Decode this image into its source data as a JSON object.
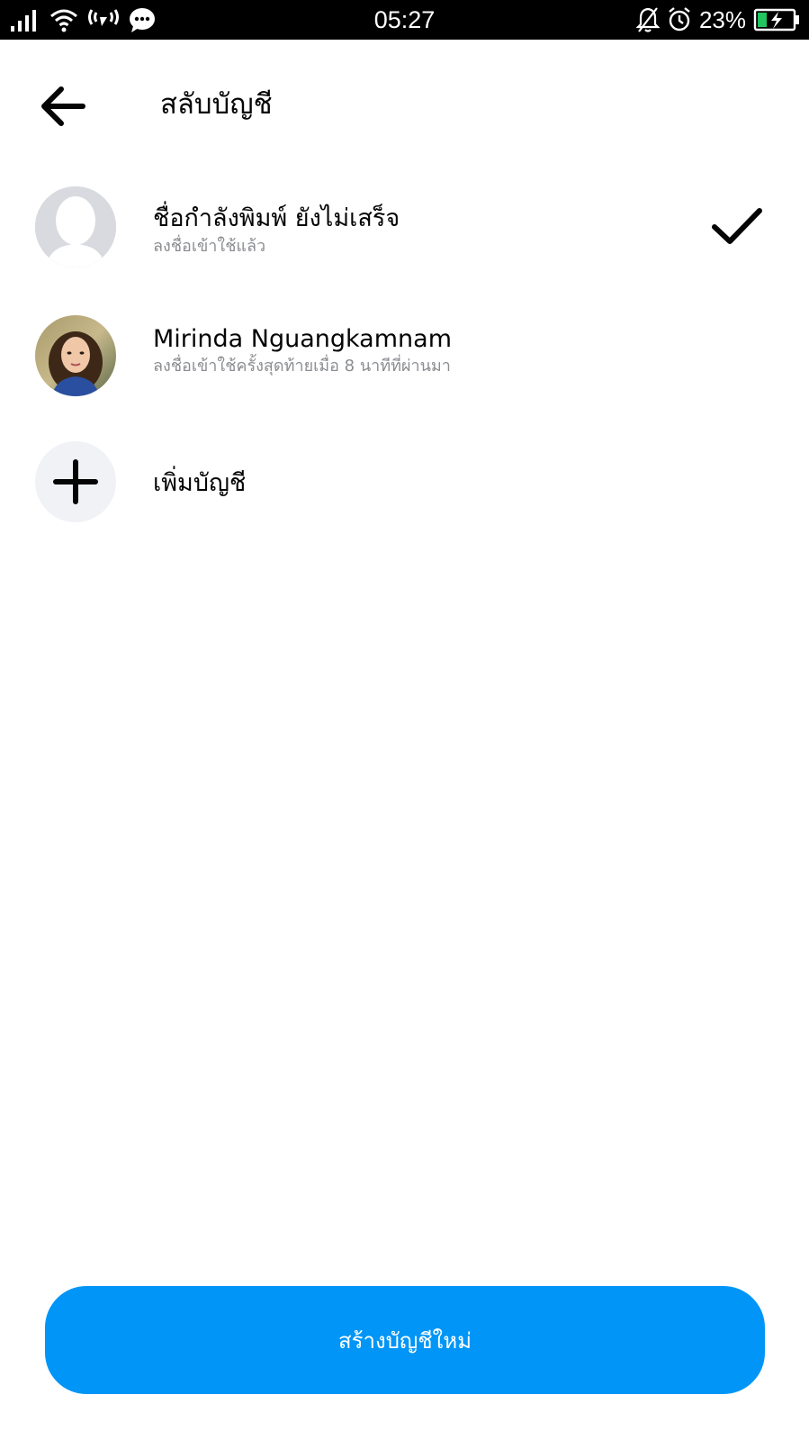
{
  "status_bar": {
    "time": "05:27",
    "battery": "23%",
    "colors": {
      "background": "#000000",
      "battery_fill": "#22c55e"
    }
  },
  "header": {
    "title": "สลับบัญชี",
    "back_icon": "arrow-left-icon"
  },
  "accounts": [
    {
      "name": "ชื่อกำลังพิมพ์ ยังไม่เสร็จ",
      "status": "ลงชื่อเข้าใช้แล้ว",
      "avatar": "default-avatar-icon",
      "selected": true
    },
    {
      "name": "Mirinda Nguangkamnam",
      "status": "ลงชื่อเข้าใช้ครั้งสุดท้ายเมื่อ 8 นาทีที่ผ่านมา",
      "avatar": "profile-photo",
      "selected": false
    }
  ],
  "add_account": {
    "label": "เพิ่มบัญชี",
    "icon": "plus-icon"
  },
  "create_button": {
    "label": "สร้างบัญชีใหม่",
    "color": "#0195f7"
  }
}
